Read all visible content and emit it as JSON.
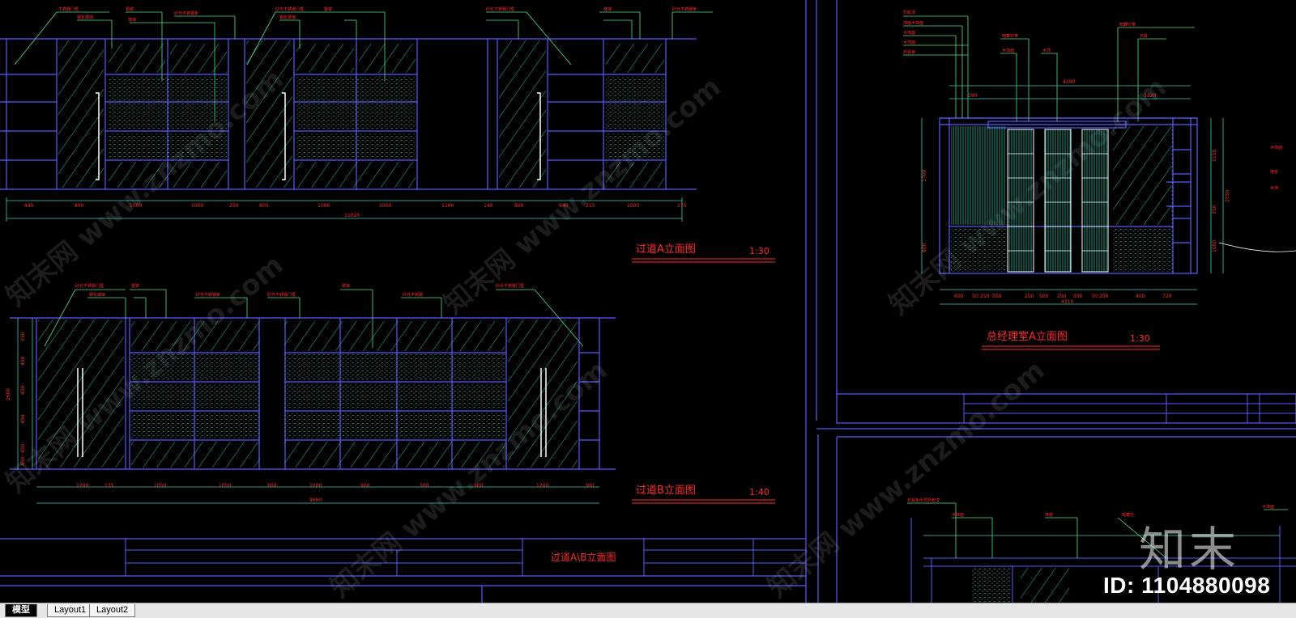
{
  "drawings": {
    "corridor_a_title": "过道A立面图",
    "corridor_a_scale": "1:30",
    "corridor_b_title": "过道B立面图",
    "corridor_b_scale": "1:40",
    "manager_title": "总经理室A立面图",
    "manager_scale": "1:30",
    "sheet_title": "过道A\\B立面图"
  },
  "dimensions": {
    "corridor_a": [
      "840",
      "800",
      "1000",
      "1000",
      "250",
      "800",
      "1000",
      "1000",
      "1100",
      "140",
      "800",
      "640",
      "215",
      "1000",
      "175"
    ],
    "corridor_a_total": "11020",
    "corridor_b": [
      "1200",
      "135",
      "1050",
      "1050",
      "600",
      "1000",
      "900",
      "500",
      "900",
      "1200",
      "360"
    ],
    "corridor_b_total": "9690",
    "corridor_b_height": "2600",
    "corridor_b_rows": [
      "350",
      "450",
      "450",
      "450",
      "450",
      "450"
    ],
    "manager_bottom": [
      "600",
      "50",
      "250",
      "500",
      "250",
      "500",
      "250",
      "500",
      "50",
      "250",
      "400",
      "720"
    ],
    "manager_total": "4310",
    "manager_top": [
      "290",
      "3220"
    ],
    "manager_top_total": "4290",
    "manager_left": [
      "1700",
      "800"
    ],
    "manager_right": [
      "1150",
      "350",
      "1000"
    ],
    "manager_right_total": "2550"
  },
  "tabs": [
    "模型",
    "Layout1",
    "Layout2"
  ],
  "watermark": {
    "brand": "知末",
    "id": "ID: 1104880098"
  },
  "colors": {
    "background": "#000000",
    "frame": "#5a5aff",
    "dimension": "#ff2a2a",
    "hatch": "#2ad3b6",
    "leader": "#4fe08a",
    "white": "#ffffff"
  }
}
